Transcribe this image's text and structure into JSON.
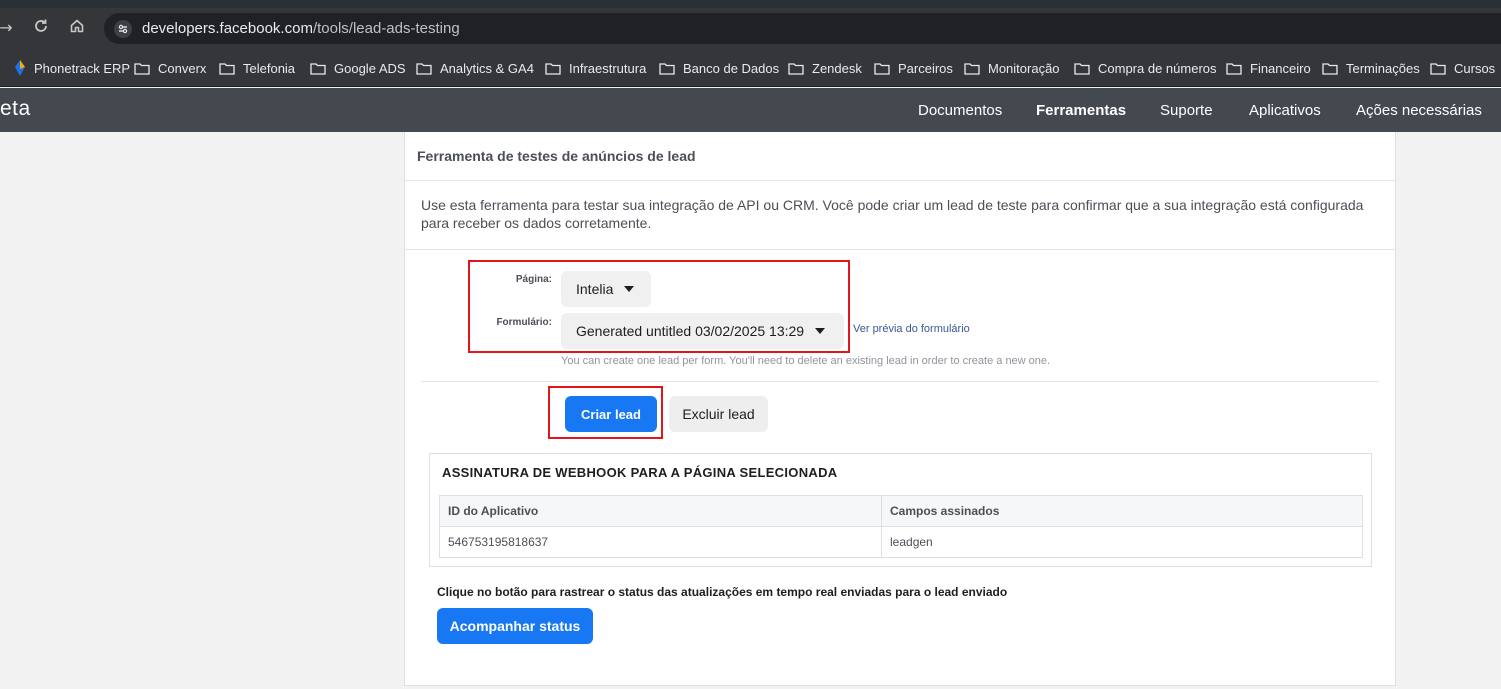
{
  "browser": {
    "url_domain": "developers.facebook.com",
    "url_path": "/tools/lead-ads-testing",
    "bookmarks": [
      "Phonetrack ERP",
      "Converx",
      "Telefonia",
      "Google ADS",
      "Analytics & GA4",
      "Infraestrutura",
      "Banco de Dados",
      "Zendesk",
      "Parceiros",
      "Monitoração",
      "Compra de números",
      "Financeiro",
      "Terminações",
      "Cursos"
    ]
  },
  "meta_nav": {
    "logo": "eta",
    "items": [
      "Documentos",
      "Ferramentas",
      "Suporte",
      "Aplicativos",
      "Ações necessárias"
    ],
    "active": "Ferramentas"
  },
  "tool": {
    "title": "Ferramenta de testes de anúncios de lead",
    "intro": "Use esta ferramenta para testar sua integração de API ou CRM. Você pode criar um lead de teste para confirmar que a sua integração está configurada para receber os dados corretamente.",
    "page_label": "Página:",
    "page_value": "Intelia",
    "form_label": "Formulário:",
    "form_value": "Generated untitled 03/02/2025 13:29",
    "preview_link": "Ver prévia do formulário",
    "hint": "You can create one lead per form. You'll need to delete an existing lead in order to create a new one.",
    "create_button": "Criar lead",
    "delete_button": "Excluir lead"
  },
  "webhook": {
    "title": "ASSINATURA DE WEBHOOK PARA A PÁGINA SELECIONADA",
    "columns": [
      "ID do Aplicativo",
      "Campos assinados"
    ],
    "rows": [
      [
        "546753195818637",
        "leadgen"
      ]
    ]
  },
  "tracking": {
    "text": "Clique no botão para rastrear o status das atualizações em tempo real enviadas para o lead enviado",
    "button": "Acompanhar status"
  },
  "colors": {
    "primary": "#1877f2",
    "highlight": "#e4141b",
    "nav_bg": "#444950"
  }
}
